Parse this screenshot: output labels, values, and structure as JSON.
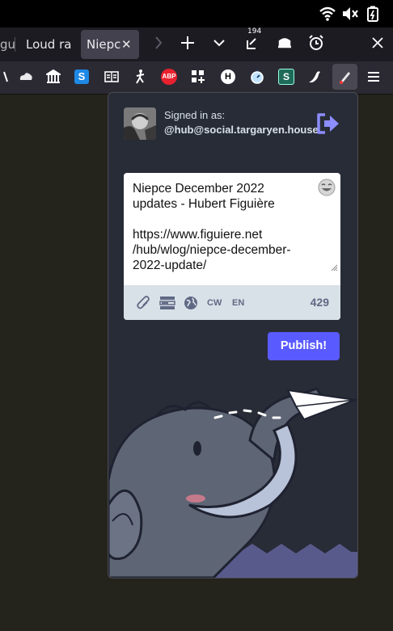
{
  "system": {
    "icons": [
      "wifi-icon",
      "volume-muted-icon",
      "battery-icon"
    ]
  },
  "tabs": [
    {
      "label": "gu",
      "active": false
    },
    {
      "label": "Loud ran",
      "active": false
    },
    {
      "label": "Niepce",
      "active": true
    }
  ],
  "tabbar": {
    "downloads_badge": "194"
  },
  "popup": {
    "signed_in_label": "Signed in as:",
    "account": "@hub@social.targaryen.house",
    "post_text": "Niepce December 2022\nupdates - Hubert Figuière\n\nhttps://www.figuiere.net\n/hub/wlog/niepce-december-\n2022-update/",
    "cw_label": "CW",
    "lang_label": "EN",
    "char_count": "429",
    "publish_label": "Publish!"
  },
  "colors": {
    "accent": "#595aff",
    "popup_bg": "#282c37",
    "toolbar_bg": "#2b2a33"
  }
}
